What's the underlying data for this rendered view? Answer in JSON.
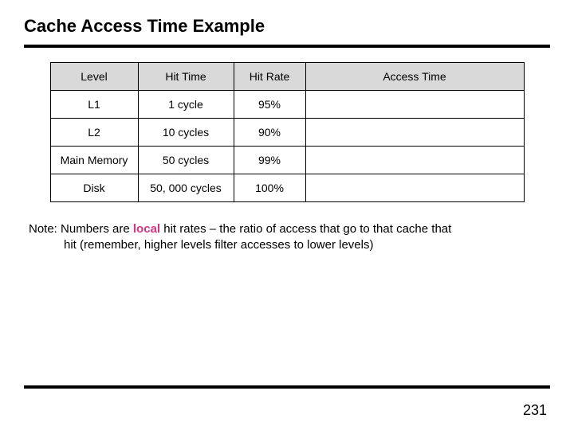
{
  "title": "Cache Access Time Example",
  "table": {
    "headers": {
      "level": "Level",
      "hit_time": "Hit Time",
      "hit_rate": "Hit Rate",
      "access_time": "Access Time"
    },
    "rows": [
      {
        "level": "L1",
        "hit_time": "1 cycle",
        "hit_rate": "95%",
        "access_time": ""
      },
      {
        "level": "L2",
        "hit_time": "10 cycles",
        "hit_rate": "90%",
        "access_time": ""
      },
      {
        "level": "Main Memory",
        "hit_time": "50 cycles",
        "hit_rate": "99%",
        "access_time": ""
      },
      {
        "level": "Disk",
        "hit_time": "50, 000 cycles",
        "hit_rate": "100%",
        "access_time": ""
      }
    ]
  },
  "note": {
    "prefix": "Note: Numbers are ",
    "emph": "local",
    "line1_rest": " hit rates – the ratio of access that go to that cache that",
    "line2": "hit (remember, higher levels filter accesses to lower levels)"
  },
  "page_number": "231",
  "colors": {
    "emph": "#d63384",
    "header_bg": "#d9d9d9"
  },
  "chart_data": {
    "type": "table",
    "columns": [
      "Level",
      "Hit Time",
      "Hit Rate",
      "Access Time"
    ],
    "rows": [
      [
        "L1",
        "1 cycle",
        "95%",
        ""
      ],
      [
        "L2",
        "10 cycles",
        "90%",
        ""
      ],
      [
        "Main Memory",
        "50 cycles",
        "99%",
        ""
      ],
      [
        "Disk",
        "50, 000 cycles",
        "100%",
        ""
      ]
    ]
  }
}
